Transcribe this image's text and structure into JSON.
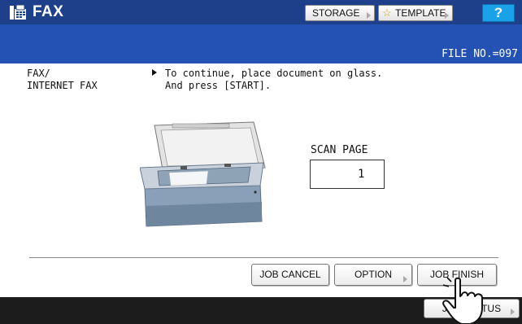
{
  "app": {
    "title": "FAX",
    "icon": "fax-machine-icon"
  },
  "toolbar": {
    "storage_label": "STORAGE",
    "template_label": "TEMPLATE",
    "template_icon": "star-icon",
    "help_label": "?"
  },
  "info": {
    "file_no": "FILE NO.=097"
  },
  "main": {
    "mode_label": "FAX/\nINTERNET FAX",
    "message": "To continue, place document on glass.\nAnd press [START].",
    "scan_page_label": "SCAN PAGE",
    "scan_page_value": "1"
  },
  "actions": {
    "job_cancel_label": "JOB CANCEL",
    "option_label": "OPTION",
    "job_finish_label": "JOB FINISH"
  },
  "status": {
    "job_status_label": "JOB STATUS"
  },
  "colors": {
    "title_bar": "#1e3f8a",
    "info_bar": "#2452b4",
    "help_button": "#1aa2e8",
    "status_bar": "#1c1c1c"
  }
}
